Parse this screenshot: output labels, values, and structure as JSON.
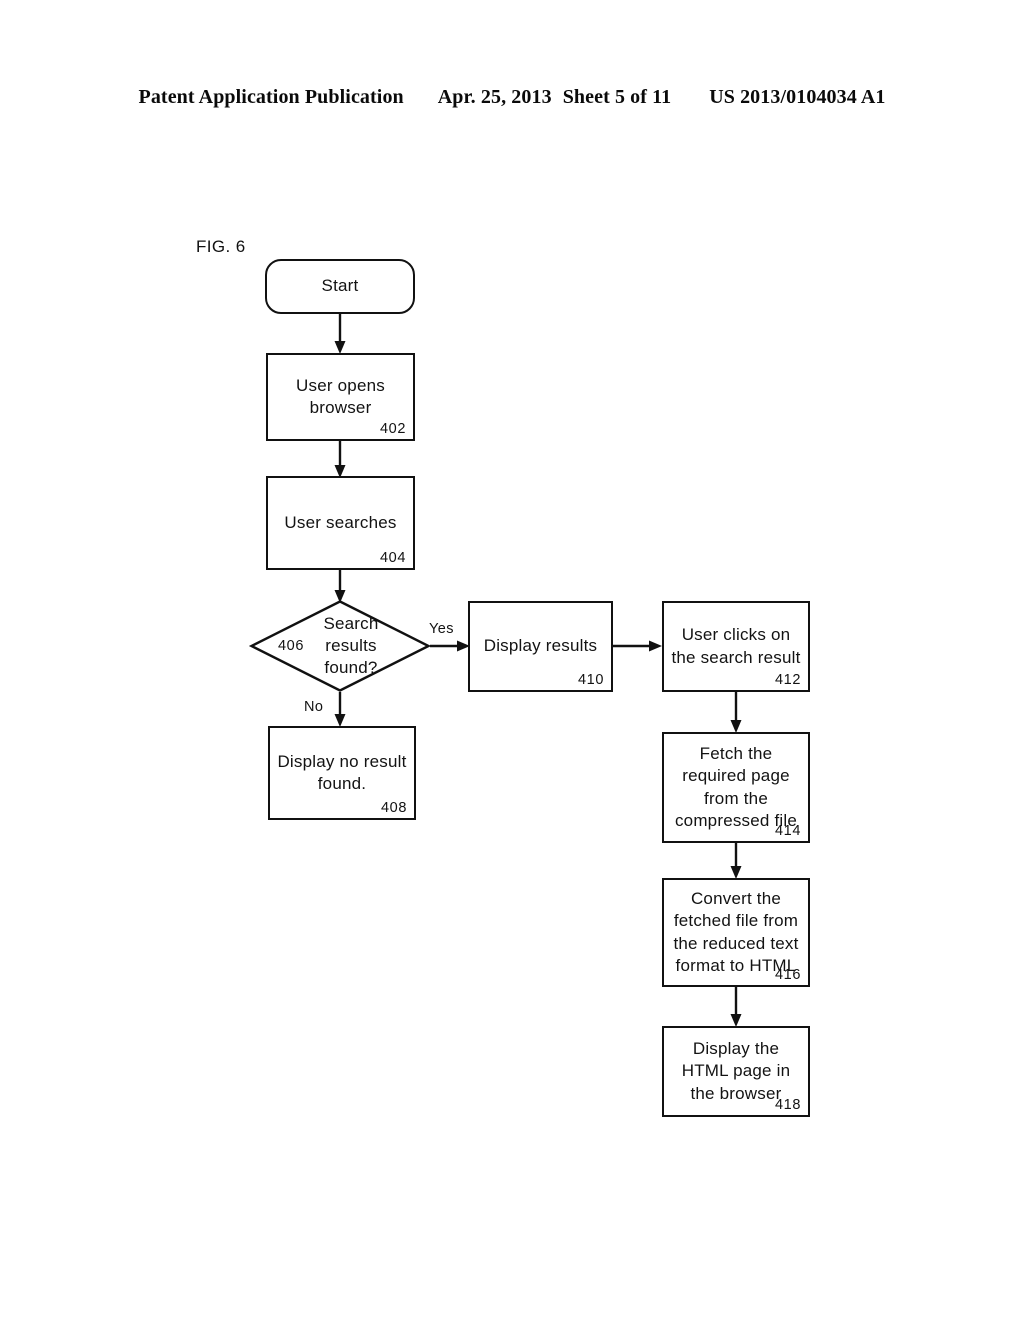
{
  "header": {
    "publication": "Patent Application Publication",
    "date": "Apr. 25, 2013",
    "sheet": "Sheet 5 of 11",
    "patent_number": "US 2013/0104034 A1"
  },
  "figure": {
    "label": "FIG. 6"
  },
  "flowchart": {
    "nodes": [
      {
        "id": "start",
        "shape": "terminator",
        "text": "Start",
        "ref": ""
      },
      {
        "id": "open-browser",
        "shape": "process",
        "text": "User opens\nbrowser",
        "ref": "402"
      },
      {
        "id": "user-search",
        "shape": "process",
        "text": "User searches",
        "ref": "404"
      },
      {
        "id": "results-found",
        "shape": "decision",
        "text": "Search\nresults\nfound?",
        "ref": "406"
      },
      {
        "id": "no-result",
        "shape": "process",
        "text": "Display no result\nfound.",
        "ref": "408"
      },
      {
        "id": "display-results",
        "shape": "process",
        "text": "Display results",
        "ref": "410"
      },
      {
        "id": "user-clicks",
        "shape": "process",
        "text": "User clicks on\nthe search result",
        "ref": "412"
      },
      {
        "id": "fetch-page",
        "shape": "process",
        "text": "Fetch the\nrequired page\nfrom the\ncompressed file",
        "ref": "414"
      },
      {
        "id": "convert-file",
        "shape": "process",
        "text": "Convert the\nfetched file from\nthe reduced text\nformat to HTML",
        "ref": "416"
      },
      {
        "id": "display-html",
        "shape": "process",
        "text": "Display the\nHTML page in\nthe browser",
        "ref": "418"
      }
    ],
    "edge_labels": {
      "yes": "Yes",
      "no": "No"
    }
  }
}
